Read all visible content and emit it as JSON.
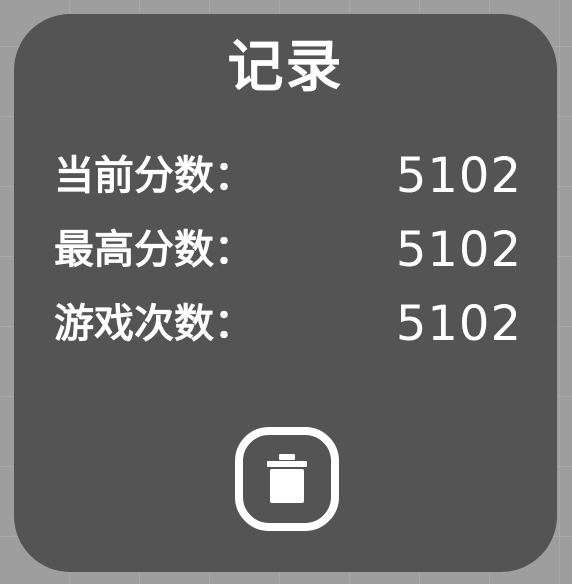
{
  "title": "记录",
  "stats": [
    {
      "label": "当前分数：",
      "value": "5102"
    },
    {
      "label": "最高分数：",
      "value": "5102"
    },
    {
      "label": "游戏次数：",
      "value": "5102"
    }
  ],
  "icons": {
    "delete_button": "trash-icon"
  },
  "colors": {
    "panel": "#545454",
    "background": "#9e9e9e",
    "text": "#ffffff"
  }
}
